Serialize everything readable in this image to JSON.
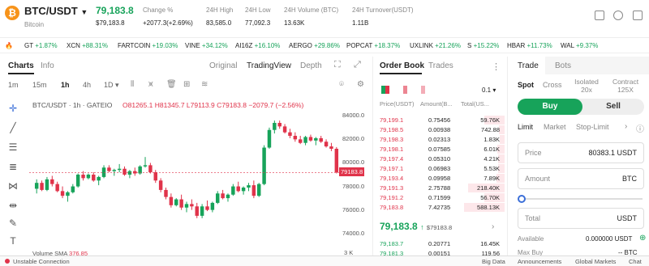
{
  "header": {
    "pair": "BTC/USDT",
    "coin_name": "Bitcoin",
    "last_price": "79,183.8",
    "last_price_usd": "$79,183.8",
    "change_label": "Change %",
    "change_value": "+2077.3(+2.69%)",
    "high_label": "24H High",
    "high_value": "83,585.0",
    "low_label": "24H Low",
    "low_value": "77,092.3",
    "volume_label": "24H Volume (BTC)",
    "volume_value": "13.63K",
    "turnover_label": "24H Turnover(USDT)",
    "turnover_value": "1.11B"
  },
  "ticker": [
    {
      "symbol": "GT",
      "change": "+1.87%"
    },
    {
      "symbol": "XCN",
      "change": "+88.31%"
    },
    {
      "symbol": "FARTCOIN",
      "change": "+19.03%"
    },
    {
      "symbol": "VINE",
      "change": "+34.12%"
    },
    {
      "symbol": "AI16Z",
      "change": "+16.10%"
    },
    {
      "symbol": "AERGO",
      "change": "+29.86%"
    },
    {
      "symbol": "POPCAT",
      "change": "+18.37%"
    },
    {
      "symbol": "UXLINK",
      "change": "+21.26%"
    },
    {
      "symbol": "S",
      "change": "+15.22%"
    },
    {
      "symbol": "HBAR",
      "change": "+11.73%"
    },
    {
      "symbol": "WAL",
      "change": "+9.37%"
    }
  ],
  "chart_tabs": {
    "charts": "Charts",
    "info": "Info",
    "original": "Original",
    "tradingview": "TradingView",
    "depth": "Depth"
  },
  "timeframes": [
    "1m",
    "15m",
    "1h",
    "4h",
    "1D"
  ],
  "chart": {
    "title": "BTC/USDT · 1h · GATEIO",
    "ohlc": "O81265.1 H81345.7 L79113.9 C79183.8 −2079.7 (−2.56%)",
    "price_tag": "79183.8",
    "volume_label": "Volume SMA",
    "volume_value": "376.85",
    "volume_tick": "3 K",
    "y_ticks": [
      "84000.0",
      "82000.0",
      "80000.0",
      "78000.0",
      "76000.0",
      "74000.0"
    ]
  },
  "chart_data": {
    "type": "candlestick",
    "ylim": [
      73500,
      84500
    ],
    "up_color": "#17a35a",
    "down_color": "#e0334a",
    "candles": [
      [
        77800,
        78600,
        77400,
        78300
      ],
      [
        78300,
        78500,
        77600,
        77700
      ],
      [
        77700,
        78800,
        77600,
        78600
      ],
      [
        78600,
        78900,
        78000,
        78200
      ],
      [
        78200,
        78400,
        77500,
        77600
      ],
      [
        77600,
        78000,
        77000,
        77200
      ],
      [
        77200,
        77600,
        76700,
        77500
      ],
      [
        77500,
        78200,
        77400,
        78000
      ],
      [
        78000,
        79100,
        77900,
        79000
      ],
      [
        79000,
        79300,
        78500,
        78700
      ],
      [
        78700,
        79100,
        78600,
        79000
      ],
      [
        79000,
        79200,
        78400,
        78500
      ],
      [
        78500,
        78900,
        78100,
        78800
      ],
      [
        78800,
        79800,
        78700,
        79600
      ],
      [
        79600,
        79800,
        79200,
        79300
      ],
      [
        79300,
        79500,
        78900,
        79400
      ],
      [
        79400,
        79900,
        79200,
        79500
      ],
      [
        79500,
        79700,
        78900,
        79000
      ],
      [
        79000,
        79400,
        78700,
        79300
      ],
      [
        79300,
        79600,
        78900,
        79100
      ],
      [
        79100,
        79800,
        79000,
        79700
      ],
      [
        79700,
        80500,
        79600,
        79800
      ],
      [
        79800,
        80000,
        79100,
        79200
      ],
      [
        79200,
        79400,
        78300,
        78500
      ],
      [
        78500,
        78700,
        77500,
        77700
      ],
      [
        77700,
        77900,
        76900,
        77100
      ],
      [
        77100,
        77400,
        76200,
        76400
      ],
      [
        76400,
        77000,
        76300,
        76900
      ],
      [
        76900,
        77300,
        76000,
        76200
      ],
      [
        76200,
        76700,
        75800,
        76500
      ],
      [
        76500,
        76900,
        76000,
        76300
      ],
      [
        76300,
        76600,
        75300,
        75500
      ],
      [
        75500,
        76500,
        75300,
        76300
      ],
      [
        76300,
        76800,
        75900,
        76000
      ],
      [
        76000,
        76700,
        75800,
        76600
      ],
      [
        76600,
        77600,
        76500,
        77400
      ],
      [
        77400,
        77700,
        76900,
        77000
      ],
      [
        77000,
        77400,
        76700,
        77300
      ],
      [
        77300,
        78200,
        77200,
        78000
      ],
      [
        78000,
        78400,
        77500,
        77600
      ],
      [
        77600,
        78000,
        77300,
        77900
      ],
      [
        77900,
        78300,
        77600,
        78100
      ],
      [
        78100,
        78500,
        77000,
        77200
      ],
      [
        77200,
        78300,
        77100,
        78200
      ],
      [
        78200,
        81500,
        78100,
        81300
      ],
      [
        81300,
        83000,
        81200,
        82800
      ],
      [
        82800,
        83600,
        82500,
        83400
      ],
      [
        83400,
        83600,
        82900,
        83100
      ],
      [
        83100,
        83300,
        82500,
        82600
      ],
      [
        82600,
        82900,
        82100,
        82300
      ],
      [
        82300,
        82600,
        81800,
        82000
      ],
      [
        82000,
        82300,
        81600,
        81700
      ],
      [
        81700,
        82300,
        81500,
        82200
      ],
      [
        82200,
        82400,
        81800,
        81900
      ],
      [
        81900,
        82200,
        81500,
        82100
      ],
      [
        82100,
        82300,
        81700,
        81800
      ],
      [
        81800,
        82000,
        81300,
        81400
      ],
      [
        81400,
        81700,
        81000,
        81200
      ],
      [
        81200,
        81345,
        79100,
        79184
      ]
    ]
  },
  "orderbook": {
    "tab_orderbook": "Order Book",
    "tab_trades": "Trades",
    "precision": "0.1",
    "col_price": "Price(USDT)",
    "col_amount": "Amount(B...",
    "col_total": "Total(US...",
    "asks": [
      {
        "price": "79,199.1",
        "amount": "0.75456",
        "total": "59.76K",
        "depth": 0.5
      },
      {
        "price": "79,198.5",
        "amount": "0.00938",
        "total": "742.88",
        "depth": 0.15
      },
      {
        "price": "79,198.3",
        "amount": "0.02313",
        "total": "1.83K",
        "depth": 0.12
      },
      {
        "price": "79,198.1",
        "amount": "0.07585",
        "total": "6.01K",
        "depth": 0.18
      },
      {
        "price": "79,197.4",
        "amount": "0.05310",
        "total": "4.21K",
        "depth": 0.16
      },
      {
        "price": "79,197.1",
        "amount": "0.06983",
        "total": "5.53K",
        "depth": 0.17
      },
      {
        "price": "79,193.4",
        "amount": "0.09958",
        "total": "7.89K",
        "depth": 0.2
      },
      {
        "price": "79,191.3",
        "amount": "2.75788",
        "total": "218.40K",
        "depth": 0.9
      },
      {
        "price": "79,191.2",
        "amount": "0.71599",
        "total": "56.70K",
        "depth": 0.5
      },
      {
        "price": "79,183.8",
        "amount": "7.42735",
        "total": "588.13K",
        "depth": 1.0
      }
    ],
    "mid_price": "79,183.8",
    "mid_usd": "$79183.8",
    "bids": [
      {
        "price": "79,183.7",
        "amount": "0.20771",
        "total": "16.45K"
      },
      {
        "price": "79,181.3",
        "amount": "0.00151",
        "total": "119.56"
      }
    ]
  },
  "trade": {
    "tab_trade": "Trade",
    "tab_bots": "Bots",
    "spot": "Spot",
    "cross": "Cross",
    "isolated": "Isolated",
    "isolated_lev": "20x",
    "contract": "Contract",
    "contract_lev": "125X",
    "buy": "Buy",
    "sell": "Sell",
    "order_types": [
      "Limit",
      "Market",
      "Stop-Limit"
    ],
    "price_label": "Price",
    "price_value": "80383.1 USDT",
    "amount_label": "Amount",
    "amount_unit": "BTC",
    "total_label": "Total",
    "total_unit": "USDT",
    "available_label": "Available",
    "available_value": "0.000000 USDT",
    "maxbuy_label": "Max Buy",
    "maxbuy_value": "-- BTC"
  },
  "footer": {
    "connection": "Unstable Connection",
    "links": [
      "Big Data",
      "Announcements",
      "Global Markets",
      "Chat"
    ]
  }
}
